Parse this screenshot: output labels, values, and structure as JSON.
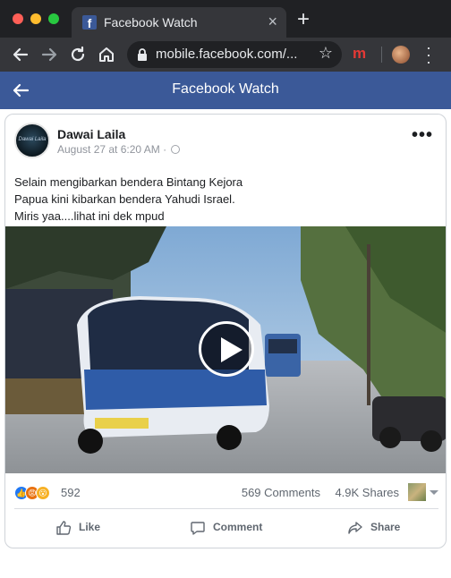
{
  "browser": {
    "tab_title": "Facebook Watch",
    "tab_favicon": "f",
    "url": "mobile.facebook.com/...",
    "extension_label": "m"
  },
  "fb_header": {
    "title": "Facebook Watch"
  },
  "post": {
    "author": "Dawai Laila",
    "avatar_text": "Dawai Laila",
    "timestamp": "August 27 at 6:20 AM · ",
    "text_lines": [
      "Selain mengibarkan bendera Bintang Kejora",
      "Papua kini kibarkan bendera Yahudi Israel.",
      "Miris yaa....lihat ini dek mpud"
    ],
    "reactions_count": "592",
    "comments": "569 Comments",
    "shares": "4.9K Shares"
  },
  "actions": {
    "like": "Like",
    "comment": "Comment",
    "share": "Share"
  },
  "colors": {
    "fb_blue": "#3b5998",
    "chrome_dark": "#202124",
    "chrome_toolbar": "#35363a"
  },
  "icons": [
    "facebook-favicon",
    "close-icon",
    "plus-icon",
    "back-arrow-icon",
    "forward-arrow-icon",
    "reload-icon",
    "home-icon",
    "lock-icon",
    "star-icon",
    "profile-avatar",
    "kebab-menu-icon",
    "globe-icon",
    "play-icon",
    "like-icon",
    "comment-icon",
    "share-icon"
  ]
}
